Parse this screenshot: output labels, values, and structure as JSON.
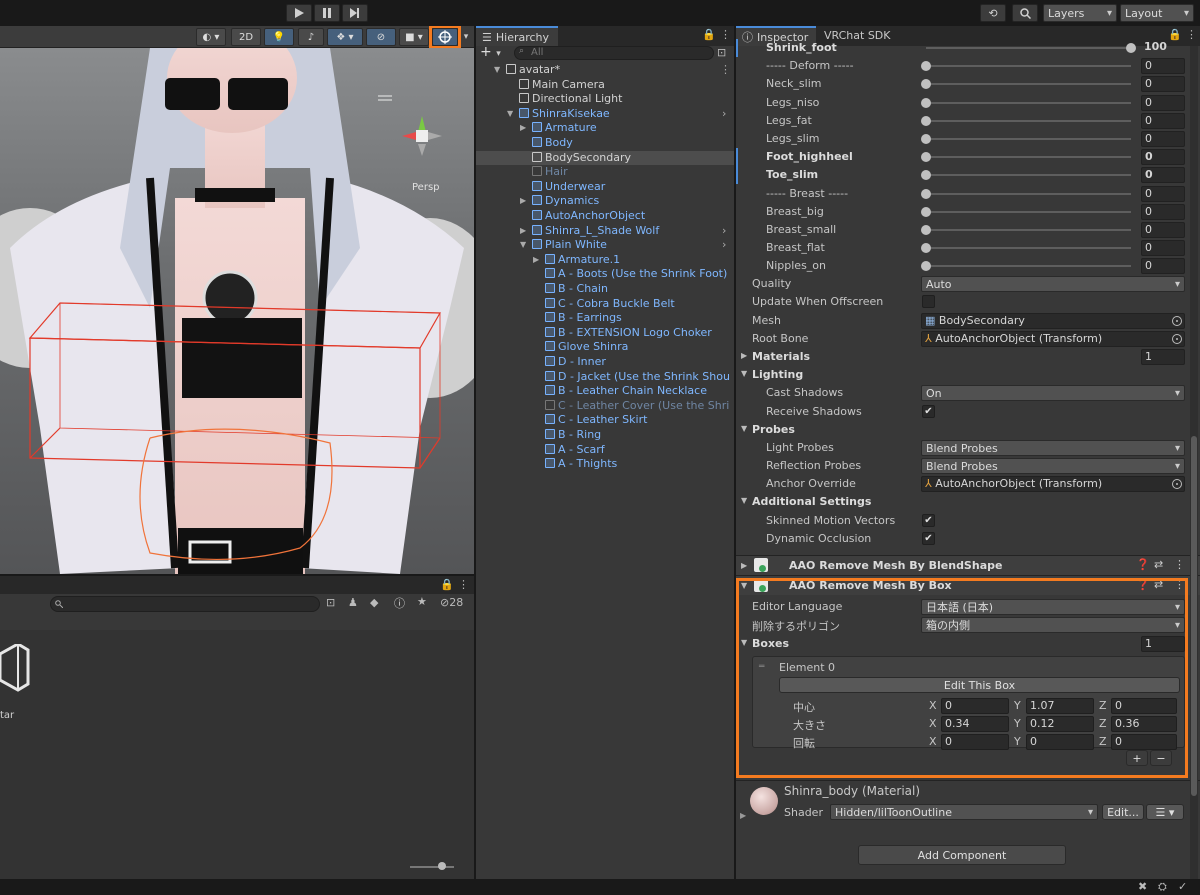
{
  "toolbar": {
    "play_icon": "play-icon",
    "pause_icon": "pause-icon",
    "step_icon": "step-icon",
    "layers_label": "Layers",
    "layout_label": "Layout"
  },
  "scene": {
    "btn_2d": "2D",
    "gizmo_label": "Persp"
  },
  "project": {
    "search_placeholder": "",
    "hidden_count": "28",
    "asset_label": "tar"
  },
  "hierarchy": {
    "tab": "Hierarchy",
    "search_placeholder": "All",
    "add_label": "+",
    "rows": [
      {
        "label": "avatar*",
        "indent": 0,
        "style": "gray"
      },
      {
        "label": "Main Camera",
        "indent": 1,
        "style": "gray"
      },
      {
        "label": "Directional Light",
        "indent": 1,
        "style": "gray"
      },
      {
        "label": "ShinraKisekae",
        "indent": 1,
        "style": "blue"
      },
      {
        "label": "Armature",
        "indent": 2,
        "style": "blue"
      },
      {
        "label": "Body",
        "indent": 2,
        "style": "blue"
      },
      {
        "label": "BodySecondary",
        "indent": 2,
        "style": "gray"
      },
      {
        "label": "Hair",
        "indent": 2,
        "style": "dim"
      },
      {
        "label": "Underwear",
        "indent": 2,
        "style": "blue"
      },
      {
        "label": "Dynamics",
        "indent": 2,
        "style": "blue"
      },
      {
        "label": "AutoAnchorObject",
        "indent": 2,
        "style": "blue"
      },
      {
        "label": "Shinra_L_Shade Wolf",
        "indent": 2,
        "style": "blue"
      },
      {
        "label": "Plain White",
        "indent": 2,
        "style": "blue"
      },
      {
        "label": "Armature.1",
        "indent": 3,
        "style": "blue"
      },
      {
        "label": "A - Boots (Use the Shrink Foot)",
        "indent": 3,
        "style": "blue"
      },
      {
        "label": "B - Chain",
        "indent": 3,
        "style": "blue"
      },
      {
        "label": "C - Cobra Buckle Belt",
        "indent": 3,
        "style": "blue"
      },
      {
        "label": "B - Earrings",
        "indent": 3,
        "style": "blue"
      },
      {
        "label": "B - EXTENSION Logo Choker",
        "indent": 3,
        "style": "blue"
      },
      {
        "label": "Glove Shinra",
        "indent": 3,
        "style": "blue"
      },
      {
        "label": "D - Inner",
        "indent": 3,
        "style": "blue"
      },
      {
        "label": "D - Jacket (Use the Shrink Shou",
        "indent": 3,
        "style": "blue"
      },
      {
        "label": "B - Leather Chain Necklace",
        "indent": 3,
        "style": "blue"
      },
      {
        "label": "C - Leather Cover  (Use the Shri",
        "indent": 3,
        "style": "dim"
      },
      {
        "label": "C - Leather Skirt",
        "indent": 3,
        "style": "blue"
      },
      {
        "label": "B - Ring",
        "indent": 3,
        "style": "blue"
      },
      {
        "label": "A - Scarf",
        "indent": 3,
        "style": "blue"
      },
      {
        "label": "A - Thights",
        "indent": 3,
        "style": "blue"
      }
    ]
  },
  "inspector": {
    "tab_inspector": "Inspector",
    "tab_vrchat": "VRChat SDK",
    "blendshapes": [
      {
        "name": "Shrink_foot",
        "value": "100",
        "fraction": 1.0,
        "bold": true
      },
      {
        "name": "----- Deform -----",
        "value": "0",
        "fraction": 0,
        "bold": false
      },
      {
        "name": "Neck_slim",
        "value": "0",
        "fraction": 0,
        "bold": false
      },
      {
        "name": "Legs_niso",
        "value": "0",
        "fraction": 0,
        "bold": false
      },
      {
        "name": "Legs_fat",
        "value": "0",
        "fraction": 0,
        "bold": false
      },
      {
        "name": "Legs_slim",
        "value": "0",
        "fraction": 0,
        "bold": false
      },
      {
        "name": "Foot_highheel",
        "value": "0",
        "fraction": 0,
        "bold": true
      },
      {
        "name": "Toe_slim",
        "value": "0",
        "fraction": 0,
        "bold": true
      },
      {
        "name": "----- Breast -----",
        "value": "0",
        "fraction": 0,
        "bold": false
      },
      {
        "name": "Breast_big",
        "value": "0",
        "fraction": 0,
        "bold": false
      },
      {
        "name": "Breast_small",
        "value": "0",
        "fraction": 0,
        "bold": false
      },
      {
        "name": "Breast_flat",
        "value": "0",
        "fraction": 0,
        "bold": false
      },
      {
        "name": "Nipples_on",
        "value": "0",
        "fraction": 0,
        "bold": false
      }
    ],
    "quality_label": "Quality",
    "quality_value": "Auto",
    "update_offscreen_label": "Update When Offscreen",
    "mesh_label": "Mesh",
    "mesh_value": "BodySecondary",
    "root_bone_label": "Root Bone",
    "root_bone_value": "AutoAnchorObject (Transform)",
    "materials_label": "Materials",
    "materials_count": "1",
    "lighting_label": "Lighting",
    "cast_shadows_label": "Cast Shadows",
    "cast_shadows_value": "On",
    "receive_shadows_label": "Receive Shadows",
    "probes_label": "Probes",
    "light_probes_label": "Light Probes",
    "light_probes_value": "Blend Probes",
    "reflection_probes_label": "Reflection Probes",
    "reflection_probes_value": "Blend Probes",
    "anchor_override_label": "Anchor Override",
    "anchor_override_value": "AutoAnchorObject (Transform)",
    "additional_settings_label": "Additional Settings",
    "skinned_motion_label": "Skinned Motion Vectors",
    "dynamic_occlusion_label": "Dynamic Occlusion",
    "comp_blendshape_title": "AAO Remove Mesh By BlendShape",
    "comp_box_title": "AAO Remove Mesh By Box",
    "editor_language_label": "Editor Language",
    "editor_language_value": "日本語 (日本)",
    "remove_polygon_label": "削除するポリゴン",
    "remove_polygon_value": "箱の内側",
    "boxes_label": "Boxes",
    "boxes_count": "1",
    "element_label": "Element 0",
    "edit_box_button": "Edit This Box",
    "center_label": "中心",
    "size_label": "大きさ",
    "rotation_label": "回転",
    "axis_x": "X",
    "axis_y": "Y",
    "axis_z": "Z",
    "center": {
      "x": "0",
      "y": "1.07",
      "z": "0"
    },
    "size": {
      "x": "0.34",
      "y": "0.12",
      "z": "0.36"
    },
    "rotation": {
      "x": "0",
      "y": "0",
      "z": "0"
    },
    "plus_label": "+",
    "minus_label": "−",
    "material_name": "Shinra_body (Material)",
    "shader_label": "Shader",
    "shader_value": "Hidden/lilToonOutline",
    "edit_shader_button": "Edit...",
    "add_component_button": "Add Component"
  },
  "colors": {
    "highlight": "#f47b20",
    "accent_blue": "#7fb7ff"
  }
}
